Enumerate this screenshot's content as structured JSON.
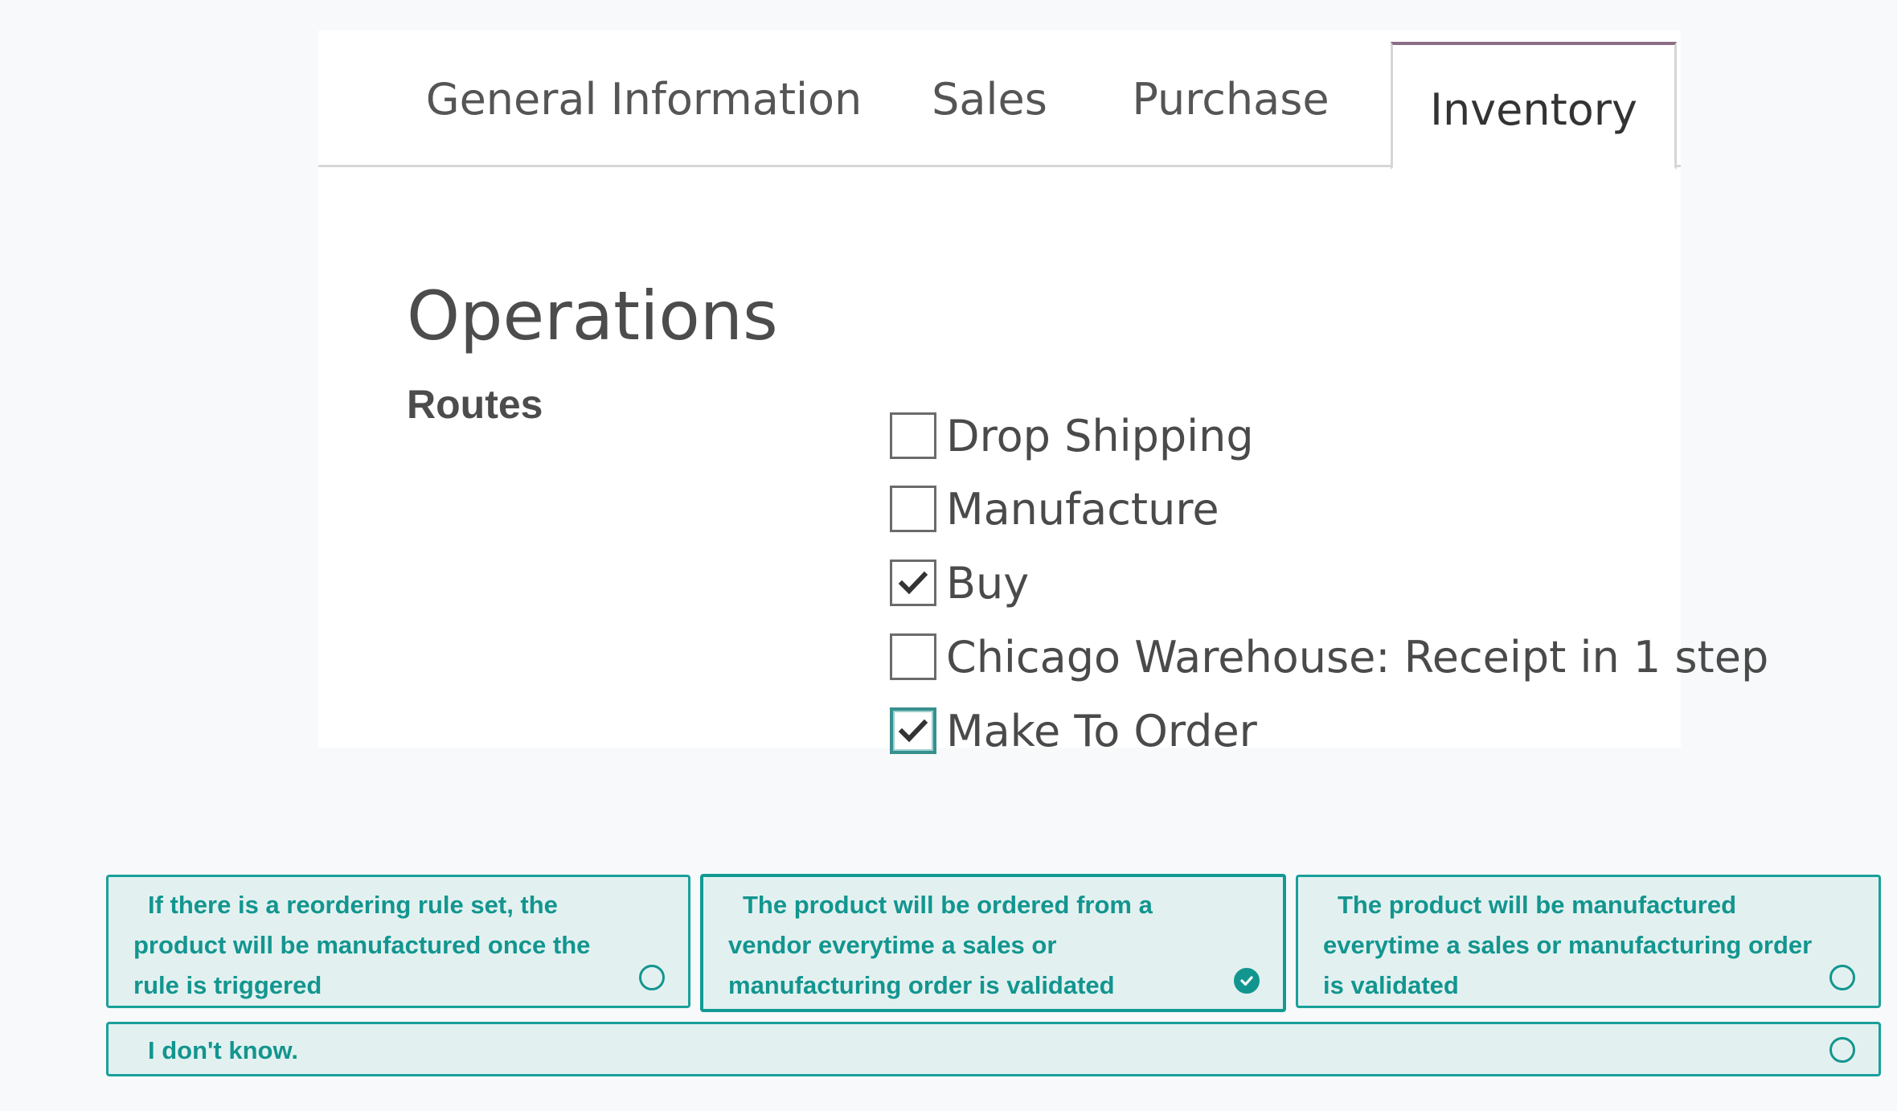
{
  "tabs": [
    {
      "label": "General Information"
    },
    {
      "label": "Sales"
    },
    {
      "label": "Purchase"
    },
    {
      "label": "Inventory",
      "active": true
    }
  ],
  "operations": {
    "title": "Operations",
    "routes_label": "Routes",
    "routes": [
      {
        "label": "Drop Shipping",
        "checked": false
      },
      {
        "label": "Manufacture",
        "checked": false
      },
      {
        "label": "Buy",
        "checked": true
      },
      {
        "label": "Chicago Warehouse: Receipt in 1 step",
        "checked": false
      },
      {
        "label": "Make To Order",
        "checked": true,
        "focused": true
      }
    ]
  },
  "answers": [
    {
      "text": "If there is a reordering rule set, the product will be manufactured once the rule is triggered",
      "selected": false
    },
    {
      "text": "The product will be ordered from a vendor everytime a sales or manufacturing order is validated",
      "selected": true
    },
    {
      "text": "The product will be manufactured everytime a sales or manufacturing order is validated",
      "selected": false
    },
    {
      "text": "I don't know.",
      "selected": false
    }
  ],
  "colors": {
    "accent": "#13958f",
    "answer_bg": "#e2f1f0",
    "tab_active_top": "#8b6e85"
  }
}
